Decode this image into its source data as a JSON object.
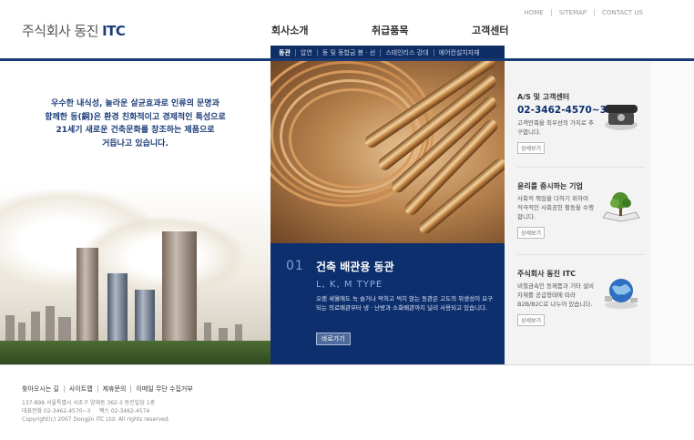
{
  "header": {
    "logo_text": "주식회사 동진",
    "logo_brand": "ITC",
    "util": [
      "HOME",
      "SITEMAP",
      "CONTACT US"
    ],
    "gnb": [
      "회사소개",
      "취급품목",
      "고객센터"
    ],
    "subnav": [
      "동관",
      "압연",
      "동 및 동합금 봉 · 선",
      "스테인리스 강대",
      "에어컨설치자재"
    ]
  },
  "left": {
    "slogan": [
      "우수한 내식성, 놀라운 살균효과로 인류의 문명과",
      "함께한 동(銅)은 환경 친화적이고 경제적인 특성으로",
      "21세기 새로운 건축문화를 창조하는 제품으로",
      "거듭나고 있습니다."
    ]
  },
  "center": {
    "number": "01",
    "title": "건축 배관용 동관",
    "subtitle": "L, K, M TYPE",
    "desc": "오랜 세월에도 녹 슬거나 막히고 썩지 않는 동관은 고도의 위생성이 요구되는 의료배관부터 냉 · 난방과 소화배관까지 널리 사용되고 있습니다.",
    "button": "바로가기"
  },
  "right": {
    "sections": [
      {
        "title": "A/S 및 고객센터",
        "phone": "02-3462-4570~3",
        "desc": "고객만족을 최우선의 가치로 추구합니다.",
        "button": "상세보기",
        "icon": "telephone-icon"
      },
      {
        "title": "윤리를 중시하는 기업",
        "desc": "사회적 책임을 다하기 위하여 적극적인 사회공헌 활동을 수행합니다.",
        "button": "상세보기",
        "icon": "book-tree-icon"
      },
      {
        "title": "주식회사 동진 ITC",
        "desc": "비철금속인 동제품과 기타 설비자재를 공급형태에 따라 B2B/B2C로 나누어 있습니다.",
        "button": "상세보기",
        "icon": "globe-icon"
      }
    ]
  },
  "footer": {
    "menu": [
      "찾아오시는 길",
      "사이트맵",
      "제휴문의",
      "이메일 무단 수집거부"
    ],
    "address": "137-898 서울특별시 서초구 양재동 362-3 동진빌딩 1층",
    "tel": "대표전화 02-3462-4570~3     팩스 02-3462-4574",
    "copyright": "Copyright(c) 2007 Dongjin ITC Ltd. All rights reserved."
  }
}
